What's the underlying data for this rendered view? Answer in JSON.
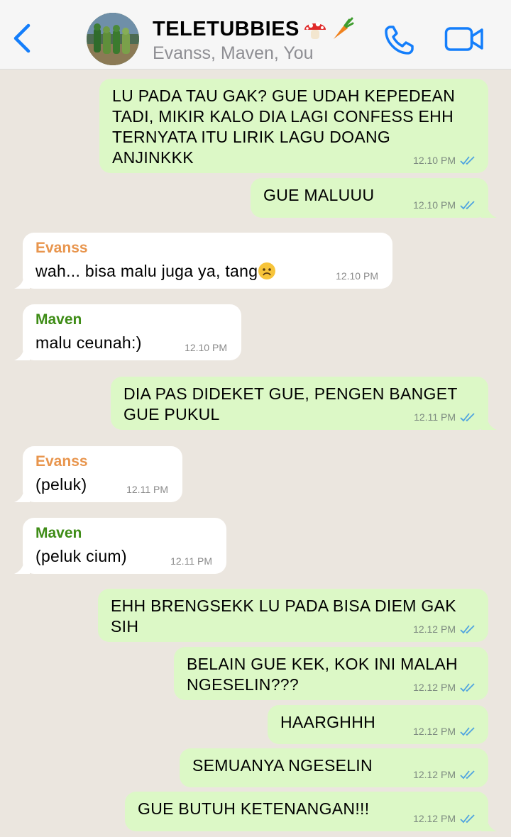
{
  "header": {
    "title": "TELETUBBIES",
    "subtitle": "Evanss, Maven, You",
    "title_emoji_icons": [
      "mushroom-icon",
      "carrot-icon"
    ]
  },
  "colors": {
    "accent": "#147efb",
    "outgoing_bubble": "#dcf8c6",
    "incoming_bubble": "#ffffff",
    "chat_background": "#ebe6df",
    "evanss_name": "#e8954d",
    "maven_name": "#3e8c16",
    "read_ticks": "#4fa3e0"
  },
  "messages": [
    {
      "dir": "out",
      "text": "LU PADA TAU GAK? GUE UDAH KEPEDEAN TADI, MIKIR KALO DIA LAGI CONFESS EHH TERNYATA ITU LIRIK LAGU DOANG ANJINKKK",
      "time": "12.10 PM"
    },
    {
      "dir": "out",
      "text": "GUE MALUUU",
      "time": "12.10 PM"
    },
    {
      "dir": "in",
      "sender": "Evanss",
      "text": "wah... bisa malu juga ya, tang",
      "emoji": "frowning-face-icon",
      "time": "12.10 PM"
    },
    {
      "dir": "in",
      "sender": "Maven",
      "text": "malu ceunah:)",
      "time": "12.10 PM"
    },
    {
      "dir": "out",
      "text": "DIA PAS DIDEKET GUE, PENGEN BANGET GUE PUKUL",
      "time": "12.11 PM"
    },
    {
      "dir": "in",
      "sender": "Evanss",
      "text": "(peluk)",
      "time": "12.11 PM"
    },
    {
      "dir": "in",
      "sender": "Maven",
      "text": "(peluk cium)",
      "time": "12.11 PM"
    },
    {
      "dir": "out",
      "text": "EHH BRENGSEKK LU PADA BISA DIEM GAK SIH",
      "time": "12.12 PM"
    },
    {
      "dir": "out",
      "text": "BELAIN GUE KEK, KOK INI MALAH NGESELIN???",
      "time": "12.12 PM"
    },
    {
      "dir": "out",
      "text": "HAARGHHH",
      "time": "12.12 PM"
    },
    {
      "dir": "out",
      "text": "SEMUANYA NGESELIN",
      "time": "12.12 PM"
    },
    {
      "dir": "out",
      "text": "GUE BUTUH KETENANGAN!!!",
      "time": "12.12 PM"
    }
  ]
}
